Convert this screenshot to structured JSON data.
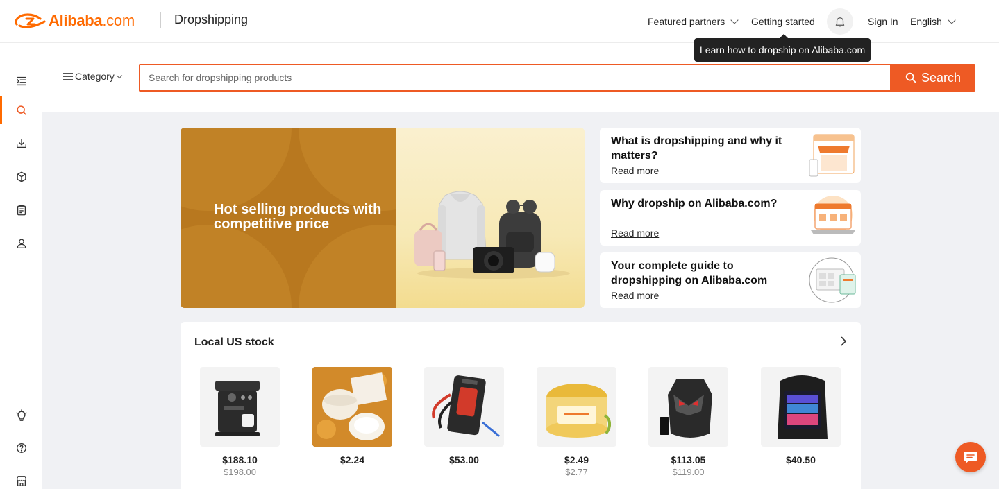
{
  "header": {
    "logo_main": "Alibaba",
    "logo_dotcom": ".com",
    "section": "Dropshipping",
    "nav": {
      "featured_partners": "Featured partners",
      "getting_started": "Getting started",
      "sign_in": "Sign In",
      "language": "English"
    },
    "tooltip": "Learn how to dropship on Alibaba.com"
  },
  "sidebar": {
    "items": [
      {
        "icon": "menu-collapse-icon"
      },
      {
        "icon": "search-icon",
        "active": true
      },
      {
        "icon": "download-icon"
      },
      {
        "icon": "box-icon"
      },
      {
        "icon": "clipboard-icon"
      },
      {
        "icon": "user-icon"
      },
      {
        "icon": "lightbulb-icon"
      },
      {
        "icon": "help-icon"
      },
      {
        "icon": "store-icon"
      }
    ]
  },
  "search": {
    "category_label": "Category",
    "placeholder": "Search for dropshipping products",
    "button_label": "Search"
  },
  "banner": {
    "headline": "Hot selling products with competitive price"
  },
  "info_cards": [
    {
      "title": "What is dropshipping and why it matters?",
      "link": "Read more"
    },
    {
      "title": "Why dropship on Alibaba.com?",
      "link": "Read more"
    },
    {
      "title": "Your complete guide to dropshipping on Alibaba.com",
      "link": "Read more"
    }
  ],
  "local_stock": {
    "title": "Local US stock",
    "products": [
      {
        "name": "espresso-machine",
        "price": "$188.10",
        "old_price": "$198.00"
      },
      {
        "name": "turmeric-cream-jar",
        "price": "$2.24",
        "old_price": ""
      },
      {
        "name": "jump-starter",
        "price": "$53.00",
        "old_price": ""
      },
      {
        "name": "turmeric-scrub-jar",
        "price": "$2.49",
        "old_price": "$2.77"
      },
      {
        "name": "led-helmet-backpack",
        "price": "$113.05",
        "old_price": "$119.00"
      },
      {
        "name": "led-display-backpack",
        "price": "$40.50",
        "old_price": ""
      }
    ]
  },
  "colors": {
    "brand": "#ff6a00",
    "search_accent": "#ee5a24",
    "banner_brown": "#b8781f",
    "banner_cream": "#faf0cf"
  }
}
